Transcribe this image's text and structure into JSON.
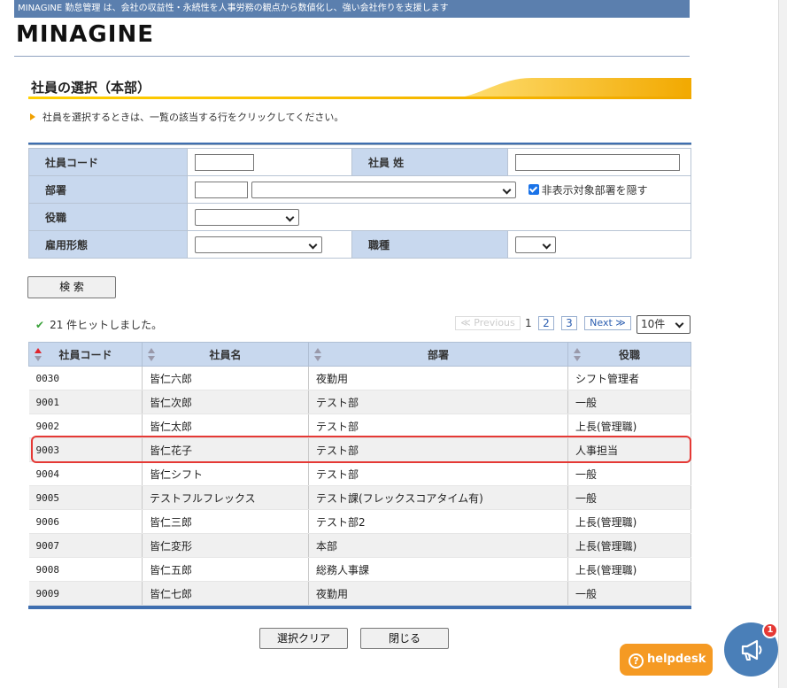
{
  "topbar": {
    "text": "MINAGINE 勤怠管理 は、会社の収益性・永続性を人事労務の観点から数値化し、強い会社作りを支援します"
  },
  "logo": {
    "text": "MINAGINE"
  },
  "section": {
    "title": "社員の選択（本部）"
  },
  "hint": "社員を選択するときは、一覧の該当する行をクリックしてください。",
  "form": {
    "employee_code_label": "社員コード",
    "surname_label": "社員 姓",
    "department_label": "部署",
    "hide_checkbox_label": "非表示対象部署を隠す",
    "hide_checked": true,
    "position_label": "役職",
    "employment_label": "雇用形態",
    "job_type_label": "職種"
  },
  "search_button": "検 索",
  "hits": "21 件ヒットしました。",
  "pager": {
    "previous": "≪ Previous",
    "current": "1",
    "pages": [
      "2",
      "3"
    ],
    "next": "Next ≫",
    "page_size": "10件"
  },
  "table": {
    "headers": [
      "社員コード",
      "社員名",
      "部署",
      "役職"
    ],
    "rows": [
      [
        "0030",
        "皆仁六郎",
        "夜勤用",
        "シフト管理者"
      ],
      [
        "9001",
        "皆仁次郎",
        "テスト部",
        "一般"
      ],
      [
        "9002",
        "皆仁太郎",
        "テスト部",
        "上長(管理職)"
      ],
      [
        "9003",
        "皆仁花子",
        "テスト部",
        "人事担当"
      ],
      [
        "9004",
        "皆仁シフト",
        "テスト部",
        "一般"
      ],
      [
        "9005",
        "テストフルフレックス",
        "テスト課(フレックスコアタイム有)",
        "一般"
      ],
      [
        "9006",
        "皆仁三郎",
        "テスト部2",
        "上長(管理職)"
      ],
      [
        "9007",
        "皆仁変形",
        "本部",
        "上長(管理職)"
      ],
      [
        "9008",
        "皆仁五郎",
        "総務人事課",
        "上長(管理職)"
      ],
      [
        "9009",
        "皆仁七郎",
        "夜勤用",
        "一般"
      ]
    ]
  },
  "buttons": {
    "clear": "選択クリア",
    "close": "閉じる"
  },
  "helpdesk": {
    "label": "helpdesk",
    "icon": "?"
  },
  "announce": {
    "badge": "1"
  },
  "colors": {
    "accent": "#3f6fb0",
    "header_bg": "#c8d8ee",
    "helpdesk": "#f59a23",
    "highlight": "#e53935"
  }
}
